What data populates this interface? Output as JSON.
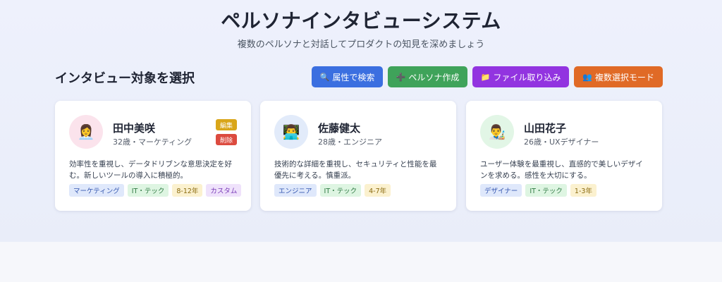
{
  "header": {
    "title": "ペルソナインタビューシステム",
    "subtitle": "複数のペルソナと対話してプロダクトの知見を深めましょう"
  },
  "section": {
    "title": "インタビュー対象を選択"
  },
  "toolbar": {
    "search_label": "属性で検索",
    "create_label": "ペルソナ作成",
    "import_label": "ファイル取り込み",
    "multi_label": "複数選択モード",
    "search_icon": "magnifier-icon",
    "create_icon": "plus-icon",
    "import_icon": "folder-icon",
    "multi_icon": "grid-icon"
  },
  "personas": [
    {
      "name": "田中美咲",
      "meta": "32歳・マーケティング",
      "avatar_icon": "woman-office-worker-icon",
      "description": "効率性を重視し、データドリブンな意思決定を好む。新しいツールの導入に積極的。",
      "tags": [
        "マーケティング",
        "IT・テック",
        "8-12年",
        "カスタム"
      ],
      "edit_label": "編集",
      "delete_label": "削除"
    },
    {
      "name": "佐藤健太",
      "meta": "28歳・エンジニア",
      "avatar_icon": "technologist-icon",
      "description": "技術的な詳細を重視し、セキュリティと性能を最優先に考える。慎重派。",
      "tags": [
        "エンジニア",
        "IT・テック",
        "4-7年"
      ]
    },
    {
      "name": "山田花子",
      "meta": "26歳・UXデザイナー",
      "avatar_icon": "artist-icon",
      "description": "ユーザー体験を最重視し、直感的で美しいデザインを求める。感性を大切にする。",
      "tags": [
        "デザイナー",
        "IT・テック",
        "1-3年"
      ]
    }
  ]
}
